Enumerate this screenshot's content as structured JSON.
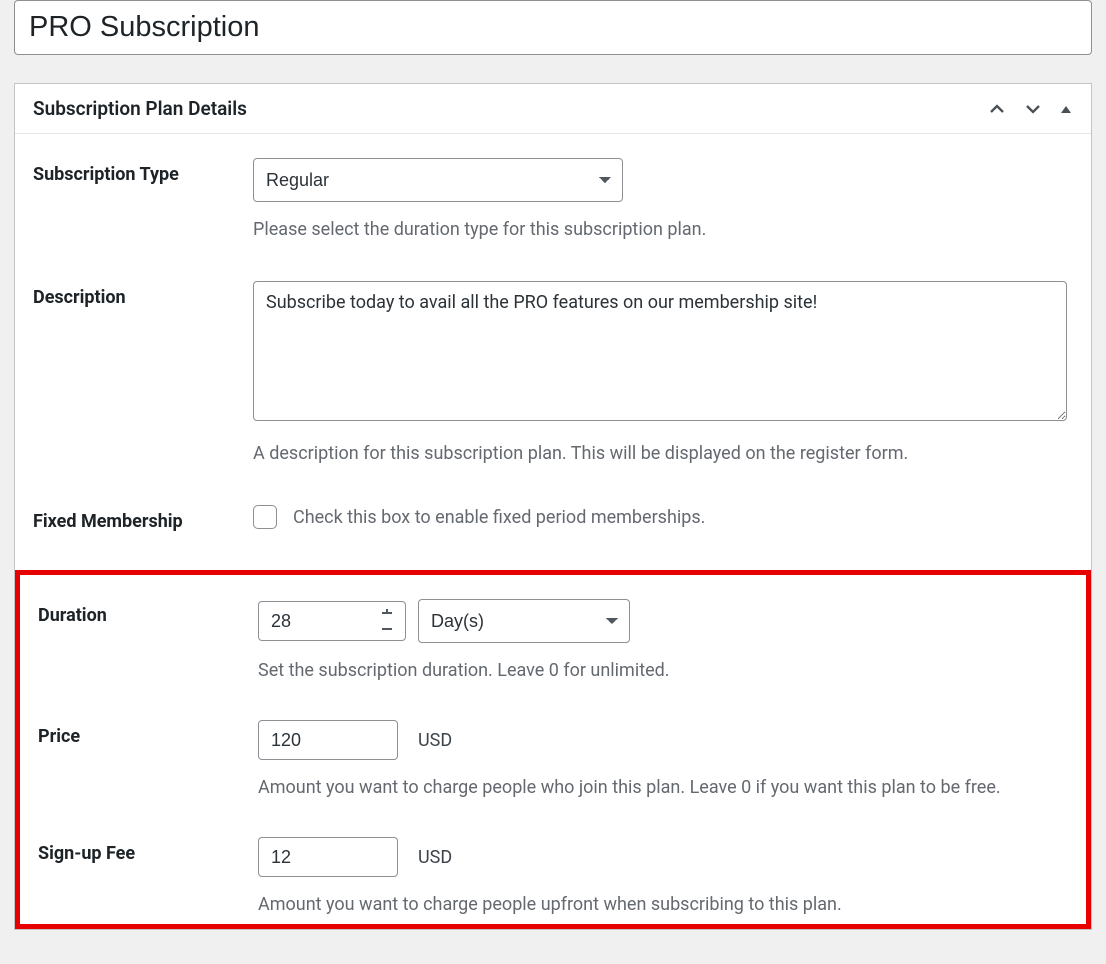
{
  "title": {
    "value": "PRO Subscription"
  },
  "metabox": {
    "title": "Subscription Plan Details"
  },
  "fields": {
    "subscription_type": {
      "label": "Subscription Type",
      "selected": "Regular",
      "help": "Please select the duration type for this subscription plan."
    },
    "description": {
      "label": "Description",
      "value": "Subscribe today to avail all the PRO features on our membership site!",
      "help": "A description for this subscription plan. This will be displayed on the register form."
    },
    "fixed_membership": {
      "label": "Fixed Membership",
      "help": "Check this box to enable fixed period memberships."
    },
    "duration": {
      "label": "Duration",
      "value": "28",
      "unit": "Day(s)",
      "help": "Set the subscription duration. Leave 0 for unlimited."
    },
    "price": {
      "label": "Price",
      "value": "120",
      "currency": "USD",
      "help": "Amount you want to charge people who join this plan. Leave 0 if you want this plan to be free."
    },
    "signup_fee": {
      "label": "Sign-up Fee",
      "value": "12",
      "currency": "USD",
      "help": "Amount you want to charge people upfront when subscribing to this plan."
    }
  }
}
